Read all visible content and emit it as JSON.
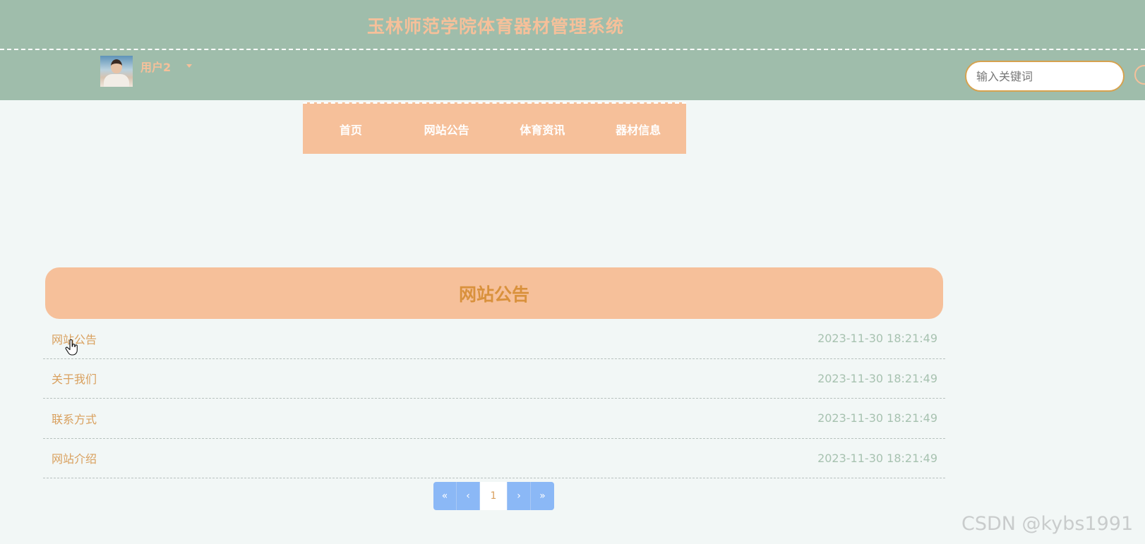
{
  "header": {
    "site_title": "玉林师范学院体育器材管理系统",
    "user": {
      "name": "用户2"
    },
    "search": {
      "placeholder": "输入关键词"
    }
  },
  "nav": {
    "items": [
      {
        "label": "首页"
      },
      {
        "label": "网站公告"
      },
      {
        "label": "体育资讯"
      },
      {
        "label": "器材信息"
      }
    ]
  },
  "main": {
    "section_title": "网站公告",
    "list": [
      {
        "title": "网站公告",
        "date": "2023-11-30 18:21:49"
      },
      {
        "title": "关于我们",
        "date": "2023-11-30 18:21:49"
      },
      {
        "title": "联系方式",
        "date": "2023-11-30 18:21:49"
      },
      {
        "title": "网站介绍",
        "date": "2023-11-30 18:21:49"
      }
    ],
    "pagination": {
      "first": "«",
      "prev": "‹",
      "current": "1",
      "next": "›",
      "last": "»"
    }
  },
  "watermark": "CSDN @kybs1991",
  "colors": {
    "header_bg": "#9fbdab",
    "accent": "#f6c09a",
    "accent_text": "#d9913c",
    "date_text": "#a7c2b0",
    "pager_bg": "#8bb8f6"
  }
}
